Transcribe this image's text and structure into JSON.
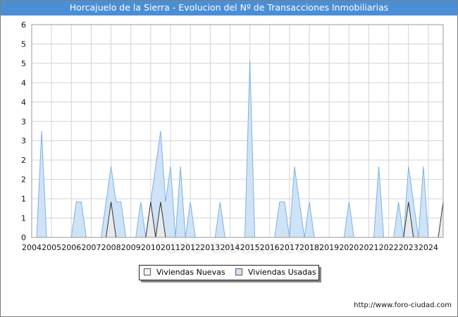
{
  "title": "Horcajuelo de la Sierra - Evolucion del Nº de Transacciones Inmobiliarias",
  "source": "http://www.foro-ciudad.com",
  "watermark": "FORO-CIUDAD.COM",
  "colors": {
    "title_bg": "#4a8fd6",
    "usadas_fill": "#cfe3f7",
    "usadas_line": "#7fb2e3",
    "nuevas_fill": "#ececec",
    "nuevas_line": "#333333",
    "grid": "#d4d4d4"
  },
  "chart_data": {
    "type": "area",
    "title": "Horcajuelo de la Sierra - Evolucion del Nº de Transacciones Inmobiliarias",
    "x_unit": "quarter",
    "xlim": [
      2004.0,
      2024.75
    ],
    "ylim": [
      0,
      6
    ],
    "y_ticks": [
      "0",
      "1",
      "1",
      "2",
      "2",
      "3",
      "3",
      "4",
      "4",
      "5",
      "5",
      "6"
    ],
    "x_ticks": [
      "2004",
      "2005",
      "2006",
      "2007",
      "2008",
      "2009",
      "2010",
      "2011",
      "2012",
      "2013",
      "2014",
      "2015",
      "2016",
      "2017",
      "2018",
      "2019",
      "2020",
      "2021",
      "2022",
      "2023",
      "2024"
    ],
    "grid": true,
    "legend_position": "bottom-center",
    "series": [
      {
        "name": "Viviendas Nuevas",
        "points": [
          [
            2007.75,
            0
          ],
          [
            2008.0,
            1
          ],
          [
            2008.25,
            0
          ],
          [
            2009.75,
            0
          ],
          [
            2010.0,
            1
          ],
          [
            2010.25,
            0
          ],
          [
            2010.5,
            1
          ],
          [
            2010.75,
            0
          ],
          [
            2022.75,
            0
          ],
          [
            2023.0,
            1
          ],
          [
            2023.25,
            0
          ],
          [
            2024.5,
            0
          ],
          [
            2024.75,
            1
          ]
        ]
      },
      {
        "name": "Viviendas Usadas",
        "points": [
          [
            2004.25,
            0
          ],
          [
            2004.5,
            3
          ],
          [
            2004.75,
            0
          ],
          [
            2006.0,
            0
          ],
          [
            2006.25,
            1
          ],
          [
            2006.5,
            1
          ],
          [
            2006.75,
            0
          ],
          [
            2007.5,
            0
          ],
          [
            2007.75,
            1
          ],
          [
            2008.0,
            2
          ],
          [
            2008.25,
            1
          ],
          [
            2008.5,
            1
          ],
          [
            2008.75,
            0
          ],
          [
            2009.25,
            0
          ],
          [
            2009.5,
            1
          ],
          [
            2009.75,
            0
          ],
          [
            2010.0,
            1
          ],
          [
            2010.25,
            2
          ],
          [
            2010.5,
            3
          ],
          [
            2010.75,
            1
          ],
          [
            2011.0,
            2
          ],
          [
            2011.25,
            0
          ],
          [
            2011.5,
            2
          ],
          [
            2011.75,
            0
          ],
          [
            2012.0,
            1
          ],
          [
            2012.25,
            0
          ],
          [
            2013.25,
            0
          ],
          [
            2013.5,
            1
          ],
          [
            2013.75,
            0
          ],
          [
            2014.75,
            0
          ],
          [
            2015.0,
            5
          ],
          [
            2015.25,
            0
          ],
          [
            2016.25,
            0
          ],
          [
            2016.5,
            1
          ],
          [
            2016.75,
            1
          ],
          [
            2017.0,
            0
          ],
          [
            2017.25,
            2
          ],
          [
            2017.5,
            1
          ],
          [
            2017.75,
            0
          ],
          [
            2018.0,
            1
          ],
          [
            2018.25,
            0
          ],
          [
            2019.75,
            0
          ],
          [
            2020.0,
            1
          ],
          [
            2020.25,
            0
          ],
          [
            2021.25,
            0
          ],
          [
            2021.5,
            2
          ],
          [
            2021.75,
            0
          ],
          [
            2022.25,
            0
          ],
          [
            2022.5,
            1
          ],
          [
            2022.75,
            0
          ],
          [
            2023.0,
            2
          ],
          [
            2023.25,
            1
          ],
          [
            2023.5,
            0
          ],
          [
            2023.75,
            2
          ],
          [
            2024.0,
            0
          ]
        ]
      }
    ]
  }
}
